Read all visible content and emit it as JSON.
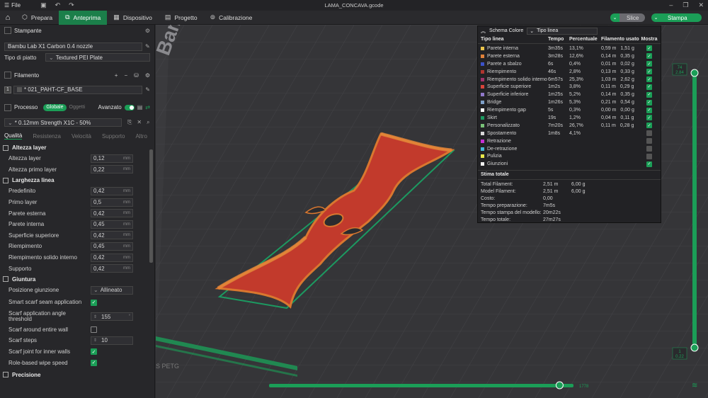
{
  "window": {
    "title": "LAMA_CONCAVA.gcode",
    "file_menu": "File"
  },
  "toolbar": {
    "tabs": [
      {
        "label": "Prepara",
        "icon": "cube-icon",
        "active": false
      },
      {
        "label": "Anteprima",
        "icon": "layers-icon",
        "active": true
      },
      {
        "label": "Dispositivo",
        "icon": "device-icon",
        "active": false
      },
      {
        "label": "Progetto",
        "icon": "project-icon",
        "active": false
      },
      {
        "label": "Calibrazione",
        "icon": "calibration-icon",
        "active": false
      }
    ],
    "slice_label": "Slice",
    "print_label": "Stampa"
  },
  "sidebar": {
    "printer_section": "Stampante",
    "printer_name": "Bambu Lab X1 Carbon 0.4 nozzle",
    "plate_type_label": "Tipo di piatto",
    "plate_type_value": "Textured PEI Plate",
    "filament_section": "Filamento",
    "filament_index": "1",
    "filament_name": "* 021_PAHT-CF_BASE",
    "process_section": "Processo",
    "global_label": "Globale",
    "objects_label": "Oggetti",
    "advanced_label": "Avanzato",
    "process_preset": "* 0.12mm Strength X1C - 50%",
    "subtabs": [
      "Qualità",
      "Resistenza",
      "Velocità",
      "Supporto",
      "Altro"
    ],
    "groups": [
      {
        "title": "Altezza layer",
        "params": [
          {
            "label": "Altezza layer",
            "value": "0,12",
            "unit": "mm"
          },
          {
            "label": "Altezza primo layer",
            "value": "0,22",
            "unit": "mm"
          }
        ]
      },
      {
        "title": "Larghezza linea",
        "params": [
          {
            "label": "Predefinito",
            "value": "0,42",
            "unit": "mm"
          },
          {
            "label": "Primo layer",
            "value": "0,5",
            "unit": "mm"
          },
          {
            "label": "Parete esterna",
            "value": "0,42",
            "unit": "mm"
          },
          {
            "label": "Parete interna",
            "value": "0,45",
            "unit": "mm"
          },
          {
            "label": "Superficie superiore",
            "value": "0,42",
            "unit": "mm"
          },
          {
            "label": "Riempimento",
            "value": "0,45",
            "unit": "mm"
          },
          {
            "label": "Riempimento solido interno",
            "value": "0,42",
            "unit": "mm"
          },
          {
            "label": "Supporto",
            "value": "0,42",
            "unit": "mm"
          }
        ]
      }
    ],
    "seam": {
      "title": "Giuntura",
      "position_label": "Posizione giunzione",
      "position_value": "Allineato",
      "smart_scarf_label": "Smart scarf seam application",
      "smart_scarf_checked": true,
      "angle_label": "Scarf application angle threshold",
      "angle_value": "155",
      "angle_unit": "°",
      "around_wall_label": "Scarf around entire wall",
      "around_wall_checked": false,
      "steps_label": "Scarf steps",
      "steps_value": "10",
      "inner_walls_label": "Scarf joint for inner walls",
      "inner_walls_checked": true,
      "wipe_label": "Role-based wipe speed",
      "wipe_checked": true
    },
    "precision_title": "Precisione"
  },
  "viewport": {
    "plate_text": "Bambu T",
    "plate_text_2": "S PETG",
    "top_slider_value": "74",
    "top_slider_value2": "2.84",
    "bottom_slider_value": "1",
    "bottom_slider_value2": "0.22",
    "h_slider_value": "1778",
    "h_slider_progress": 0.84
  },
  "legend": {
    "title": "Schema Colore",
    "mode": "Tipo linea",
    "columns": [
      "Tipo linea",
      "Tempo",
      "Percentuale",
      "Filamento usato",
      "Mostra"
    ],
    "rows": [
      {
        "color": "#e8c24a",
        "label": "Parete interna",
        "time": "3m35s",
        "pct": "13,1%",
        "m": "0,59 m",
        "g": "1,51 g",
        "show": true
      },
      {
        "color": "#e0813a",
        "label": "Parete esterna",
        "time": "3m28s",
        "pct": "12,6%",
        "m": "0,14 m",
        "g": "0,35 g",
        "show": true
      },
      {
        "color": "#3b52c9",
        "label": "Parete a sbalzo",
        "time": "6s",
        "pct": "0,4%",
        "m": "0,01 m",
        "g": "0,02 g",
        "show": true
      },
      {
        "color": "#b0352f",
        "label": "Riempimento",
        "time": "46s",
        "pct": "2,8%",
        "m": "0,13 m",
        "g": "0,33 g",
        "show": true
      },
      {
        "color": "#a0336b",
        "label": "Riempimento solido interno",
        "time": "6m57s",
        "pct": "25,3%",
        "m": "1,03 m",
        "g": "2,62 g",
        "show": true
      },
      {
        "color": "#d9443b",
        "label": "Superficie superiore",
        "time": "1m2s",
        "pct": "3,8%",
        "m": "0,11 m",
        "g": "0,29 g",
        "show": true
      },
      {
        "color": "#8f78c9",
        "label": "Superficie inferiore",
        "time": "1m25s",
        "pct": "5,2%",
        "m": "0,14 m",
        "g": "0,35 g",
        "show": true
      },
      {
        "color": "#7fa0c8",
        "label": "Bridge",
        "time": "1m26s",
        "pct": "5,3%",
        "m": "0,21 m",
        "g": "0,54 g",
        "show": true
      },
      {
        "color": "#ffffff",
        "label": "Riempimento gap",
        "time": "5s",
        "pct": "0,3%",
        "m": "0,00 m",
        "g": "0,00 g",
        "show": true
      },
      {
        "color": "#1c9a61",
        "label": "Skirt",
        "time": "19s",
        "pct": "1,2%",
        "m": "0,04 m",
        "g": "0,11 g",
        "show": true
      },
      {
        "color": "#79c278",
        "label": "Personalizzato",
        "time": "7m20s",
        "pct": "26,7%",
        "m": "0,11 m",
        "g": "0,28 g",
        "show": true
      },
      {
        "color": "#d8d8d8",
        "label": "Spostamento",
        "time": "1m8s",
        "pct": "4,1%",
        "m": "",
        "g": "",
        "show": false
      },
      {
        "color": "#c62fd3",
        "label": "Retrazione",
        "time": "",
        "pct": "",
        "m": "",
        "g": "",
        "show": false
      },
      {
        "color": "#47b7d6",
        "label": "De-retrazione",
        "time": "",
        "pct": "",
        "m": "",
        "g": "",
        "show": false
      },
      {
        "color": "#e8e64a",
        "label": "Pulizia",
        "time": "",
        "pct": "",
        "m": "",
        "g": "",
        "show": false
      },
      {
        "color": "#f0f0f0",
        "label": "Giunzioni",
        "time": "",
        "pct": "",
        "m": "",
        "g": "",
        "show": true
      }
    ],
    "stats_title": "Stima totale",
    "stats": [
      {
        "label": "Total Filament:",
        "v1": "2,51 m",
        "v2": "6,00 g"
      },
      {
        "label": "Model Filament:",
        "v1": "2,51 m",
        "v2": "6,00 g"
      },
      {
        "label": "Costo:",
        "v1": "0,00",
        "v2": ""
      },
      {
        "label": "Tempo preparazione:",
        "v1": "7m5s",
        "v2": ""
      },
      {
        "label": "Tempo stampa del modello:",
        "v1": "20m22s",
        "v2": ""
      },
      {
        "label": "Tempo totale:",
        "v1": "27m27s",
        "v2": ""
      }
    ]
  }
}
